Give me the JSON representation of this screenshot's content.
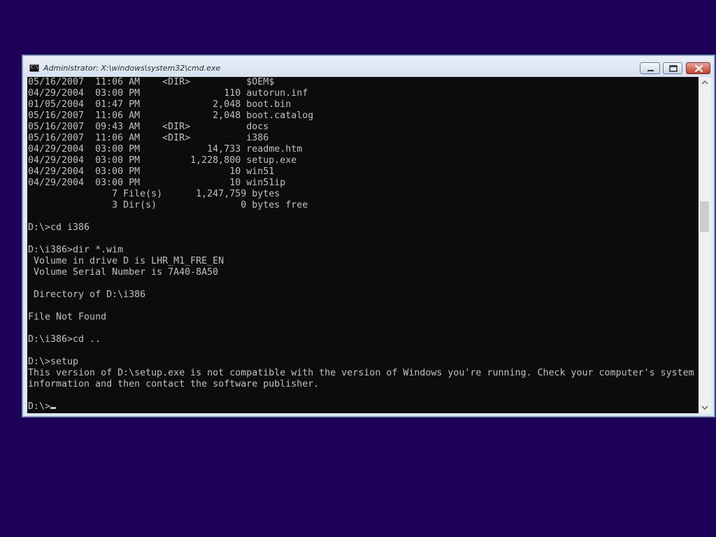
{
  "window": {
    "title": "Administrator: X:\\windows\\system32\\cmd.exe",
    "icon": "console-icon",
    "controls": {
      "minimize": "minimize-icon",
      "maximize": "maximize-icon",
      "close": "close-icon"
    }
  },
  "console": {
    "lines": [
      "05/16/2007  11:06 AM    <DIR>          $OEM$",
      "04/29/2004  03:00 PM               110 autorun.inf",
      "01/05/2004  01:47 PM             2,048 boot.bin",
      "05/16/2007  11:06 AM             2,048 boot.catalog",
      "05/16/2007  09:43 AM    <DIR>          docs",
      "05/16/2007  11:06 AM    <DIR>          i386",
      "04/29/2004  03:00 PM            14,733 readme.htm",
      "04/29/2004  03:00 PM         1,228,800 setup.exe",
      "04/29/2004  03:00 PM                10 win51",
      "04/29/2004  03:00 PM                10 win51ip",
      "               7 File(s)      1,247,759 bytes",
      "               3 Dir(s)               0 bytes free",
      "",
      "D:\\>cd i386",
      "",
      "D:\\i386>dir *.wim",
      " Volume in drive D is LHR_M1_FRE_EN",
      " Volume Serial Number is 7A40-8A50",
      "",
      " Directory of D:\\i386",
      "",
      "File Not Found",
      "",
      "D:\\i386>cd ..",
      "",
      "D:\\>setup",
      "This version of D:\\setup.exe is not compatible with the version of Windows you're running. Check your computer's system",
      "information and then contact the software publisher.",
      ""
    ],
    "prompt": "D:\\>"
  },
  "colors": {
    "desktop": "#1d0057",
    "console_bg": "#0c0c0c",
    "console_text": "#c0c0c0"
  }
}
